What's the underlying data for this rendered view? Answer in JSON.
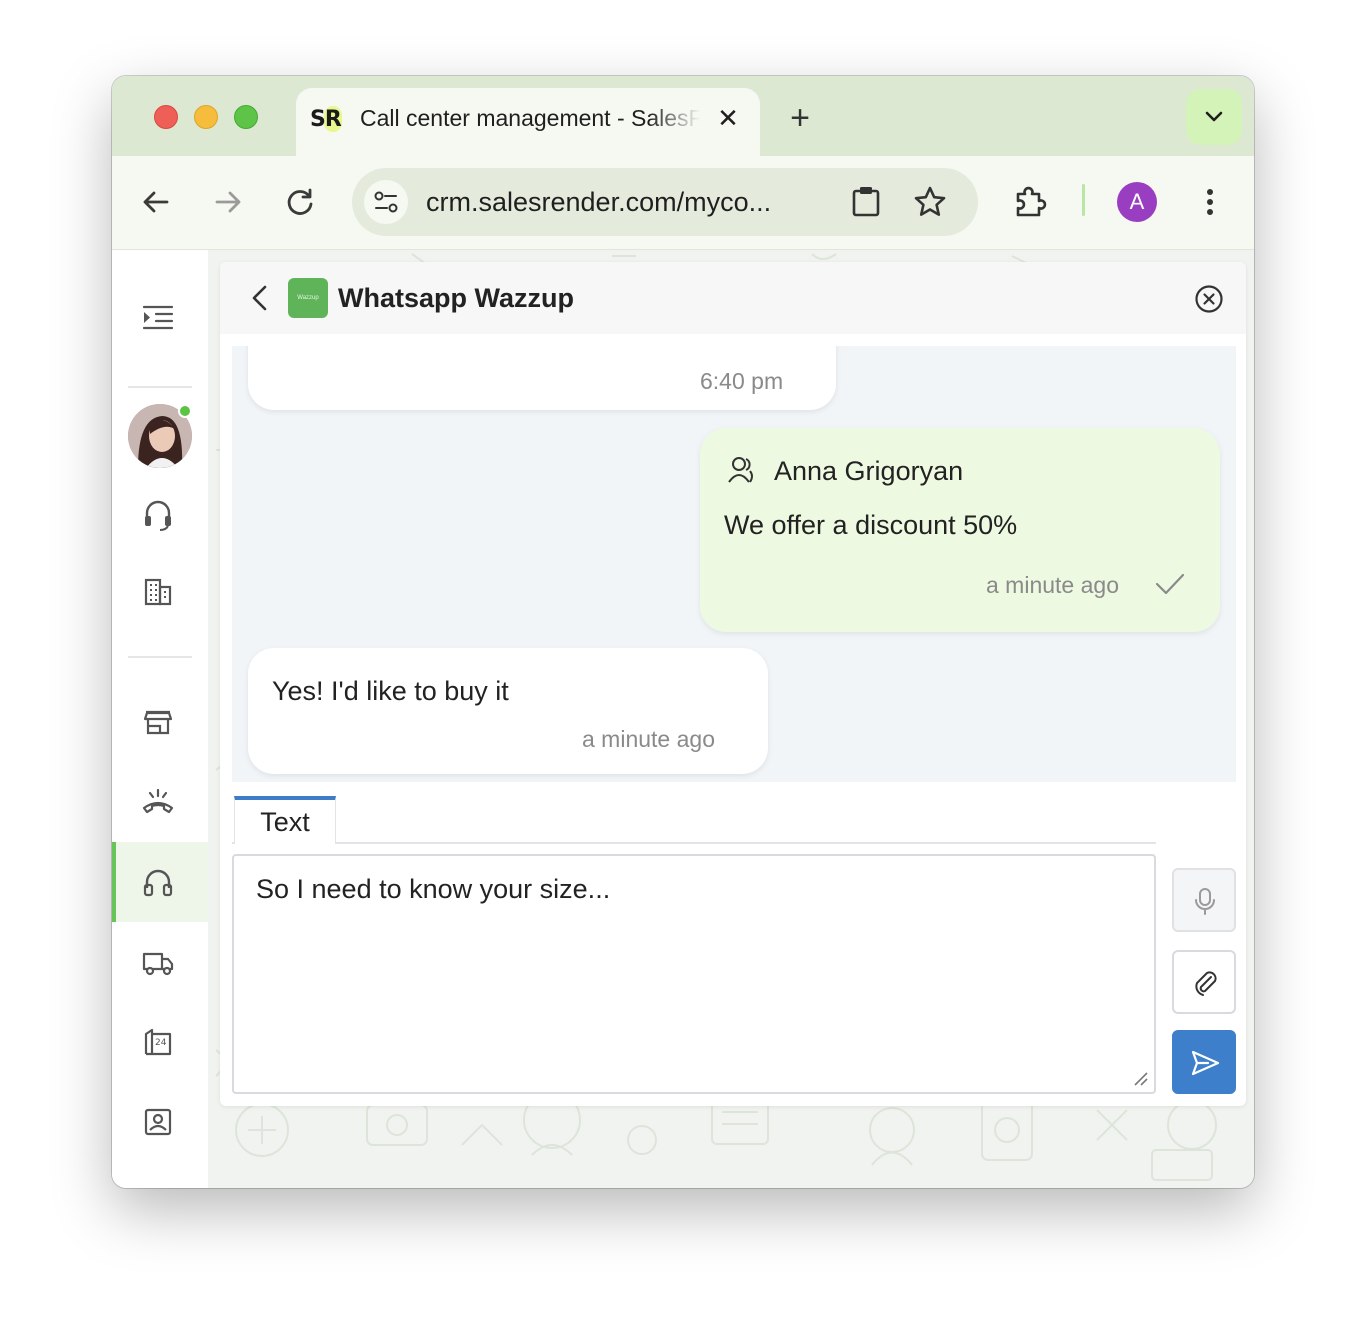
{
  "browser": {
    "tab": {
      "favicon_text": "SR",
      "title": "Call center management - SalesRender",
      "close_icon": "close-icon"
    },
    "new_tab_icon": "plus-icon",
    "tab_list_icon": "chevron-down-icon",
    "toolbar": {
      "back_icon": "arrow-left-icon",
      "forward_icon": "arrow-right-icon",
      "reload_icon": "reload-icon",
      "site_info_icon": "tune-icon",
      "url": "crm.salesrender.com/myco...",
      "clipboard_icon": "clipboard-icon",
      "bookmark_icon": "star-icon",
      "extensions_icon": "puzzle-icon",
      "profile_initial": "A",
      "menu_icon": "kebab-menu-icon"
    },
    "colors": {
      "tabstrip": "#dce8d2",
      "toolbar": "#f6f9f2",
      "profile": "#9a3ec1",
      "accent_green": "#67c457",
      "send_blue": "#3e7fcb"
    }
  },
  "sidebar": {
    "items": [
      {
        "icon": "menu-expand-icon"
      },
      {
        "icon": "user-avatar",
        "status": "online"
      },
      {
        "icon": "headset-icon"
      },
      {
        "icon": "building-icon"
      },
      {
        "icon": "store-icon"
      },
      {
        "icon": "phone-hangup-icon"
      },
      {
        "icon": "headphones-icon",
        "active": true
      },
      {
        "icon": "truck-icon"
      },
      {
        "icon": "24h-building-icon"
      },
      {
        "icon": "contact-card-icon"
      }
    ]
  },
  "chat": {
    "logo_text": "Wazzup",
    "title": "Whatsapp Wazzup",
    "messages": [
      {
        "direction": "incoming",
        "text": "",
        "time": "6:40 pm"
      },
      {
        "direction": "outgoing",
        "sender": "Anna Grigoryan",
        "text": "We offer a discount 50%",
        "time": "a minute ago",
        "status": "sent"
      },
      {
        "direction": "incoming",
        "text": "Yes! I'd like to buy it",
        "time": "a minute ago"
      }
    ],
    "composer": {
      "tab_label": "Text",
      "value": "So I need to know your size..."
    }
  }
}
